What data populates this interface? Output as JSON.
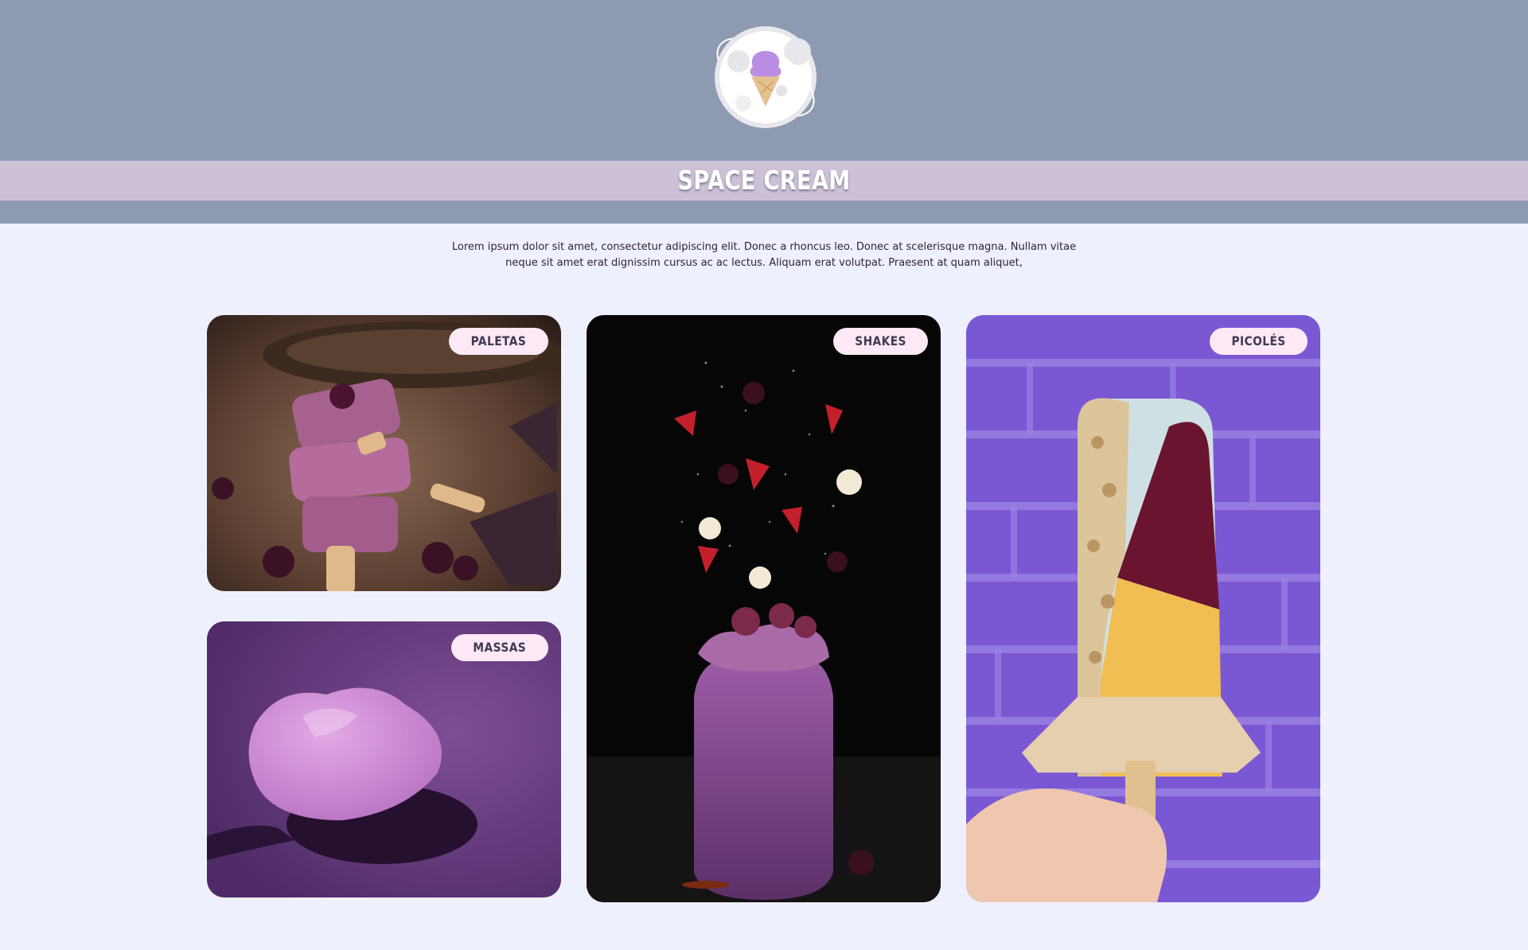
{
  "brand": {
    "name": "SPACE CREAM",
    "logo_icon": "ice-cream-planet-icon"
  },
  "intro": {
    "text": "Lorem ipsum dolor sit amet, consectetur adipiscing elit. Donec a rhoncus leo. Donec at scelerisque magna. Nullam vitae neque sit amet erat dignissim cursus ac ac lectus. Aliquam erat volutpat. Praesent at quam aliquet,"
  },
  "categories": [
    {
      "label": "PALETAS"
    },
    {
      "label": "MASSAS"
    },
    {
      "label": "SHAKES"
    },
    {
      "label": "PICOLÉS"
    }
  ],
  "colors": {
    "header": "#8d9ab2",
    "title_band": "#cdc1d6",
    "page_background": "#eff0fd",
    "pill_background": "#fde8f5",
    "pill_text": "#3f3a52"
  }
}
